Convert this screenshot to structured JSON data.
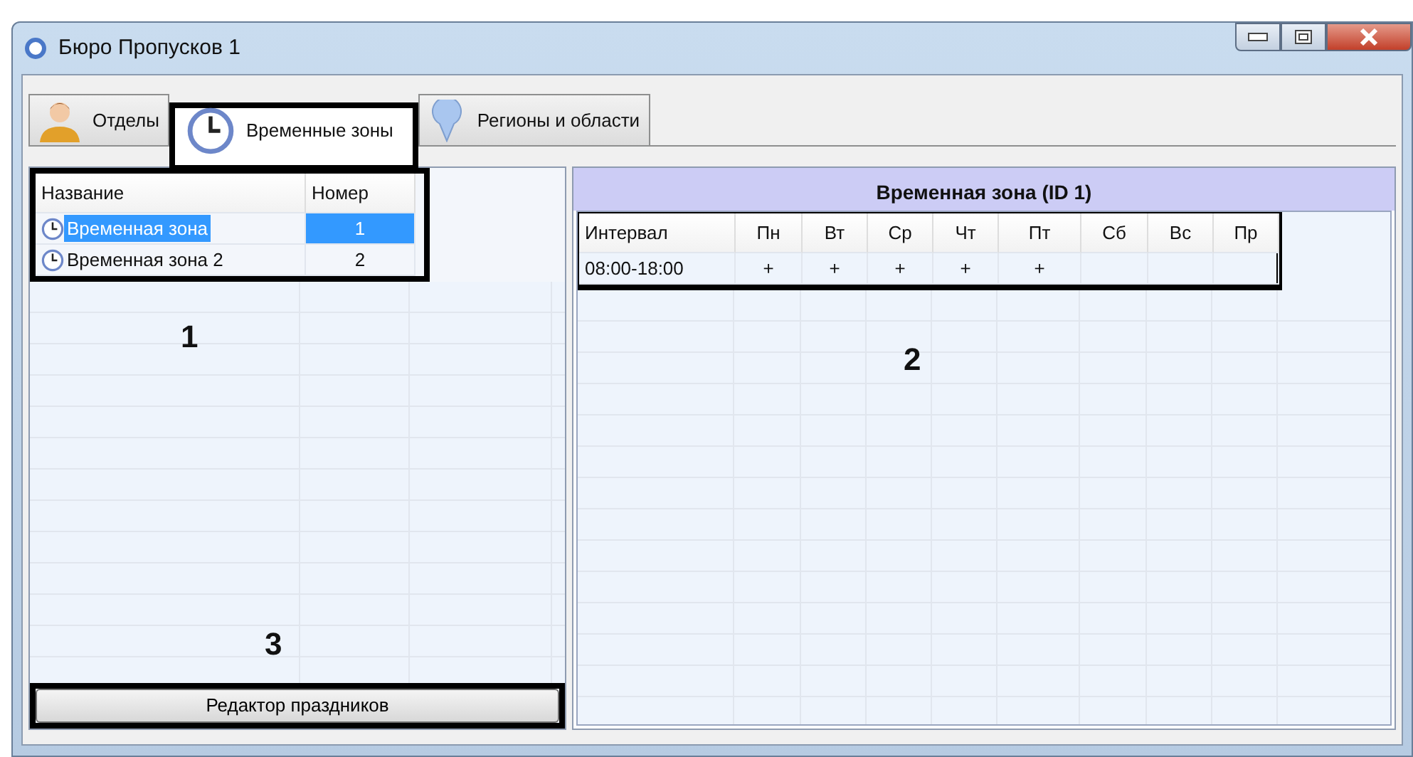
{
  "window": {
    "title": "Бюро Пропусков 1"
  },
  "tabs": [
    {
      "label": "Отделы",
      "selected": false,
      "kind": "person"
    },
    {
      "label": "Временные зоны",
      "selected": true,
      "kind": "clock"
    },
    {
      "label": "Регионы и области",
      "selected": false,
      "kind": "pin"
    }
  ],
  "zones_list": {
    "callout": "1",
    "columns": [
      "Название",
      "Номер"
    ],
    "rows": [
      {
        "name": "Временная зона",
        "number": "1",
        "selected": true
      },
      {
        "name": "Временная зона 2",
        "number": "2",
        "selected": false
      }
    ]
  },
  "schedule": {
    "title": "Временная зона (ID 1)",
    "callout": "2",
    "columns": [
      "Интервал",
      "Пн",
      "Вт",
      "Ср",
      "Чт",
      "Пт",
      "Сб",
      "Вс",
      "Пр"
    ],
    "rows": [
      {
        "interval": "08:00-18:00",
        "marks": [
          "+",
          "+",
          "+",
          "+",
          "+"
        ]
      }
    ]
  },
  "holiday_button": {
    "label": "Редактор праздников",
    "callout": "3"
  }
}
